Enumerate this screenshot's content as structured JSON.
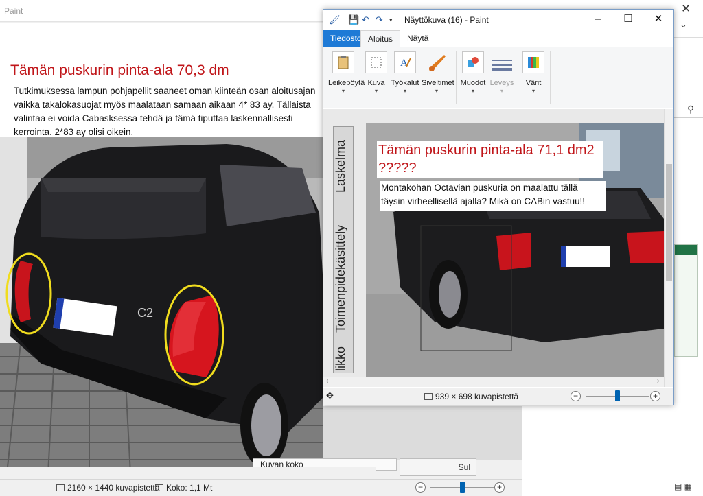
{
  "back_window": {
    "title": "Paint",
    "slide": {
      "title": "Tämän puskurin pinta-ala 70,3 dm",
      "text": "Tutkimuksessa lampun pohjapellit saaneet oman kiinteän osan aloitusajan vaikka takalokasuojat myös maalataan samaan aikaan 4* 83 ay. Tällaista valintaa ei voida Cabasksessa tehdä ja tämä tiputtaa laskennallisesti kerrointa. 2*83 ay olisi oikein.",
      "car_badge": "C2"
    },
    "group_label": "Kuvan koko",
    "partial_button": "Sul",
    "status": {
      "dimensions": "2160 × 1440 kuvapistettä",
      "size": "Koko: 1,1 Mt",
      "zoom_level": 0.5
    }
  },
  "front_window": {
    "title": "Näyttökuva (16) - Paint",
    "tabs": [
      "Tiedosto",
      "Aloitus",
      "Näytä"
    ],
    "ribbon": [
      {
        "label": "Leikepöytä",
        "icon": "clipboard-icon",
        "enabled": true
      },
      {
        "label": "Kuva",
        "icon": "image-select-icon",
        "enabled": true
      },
      {
        "label": "Työkalut",
        "icon": "tools-icon",
        "enabled": true
      },
      {
        "label": "Siveltimet",
        "icon": "brush-icon",
        "enabled": true
      },
      {
        "label": "Muodot",
        "icon": "shapes-icon",
        "enabled": true
      },
      {
        "label": "Leveys",
        "icon": "line-width-icon",
        "enabled": false
      },
      {
        "label": "Värit",
        "icon": "palette-icon",
        "enabled": true
      }
    ],
    "inner_content": {
      "vertical_tabs": [
        "Laskelma",
        "Toimenpidekäsittely",
        "likko"
      ],
      "title": "Tämän puskurin pinta-ala 71,1 dm2  ?????",
      "text": "Montakohan Octavian puskuria on maalattu tällä täysin virheellisellä ajalla? Mikä on CABin vastuu!!"
    },
    "status": {
      "dimensions": "939 × 698 kuvapistettä",
      "zoom_level": 0.5
    }
  },
  "colors": {
    "accent": "#1e7ad6",
    "slide_title_red": "#c0161a",
    "annotation_yellow": "#f0dc1e"
  }
}
